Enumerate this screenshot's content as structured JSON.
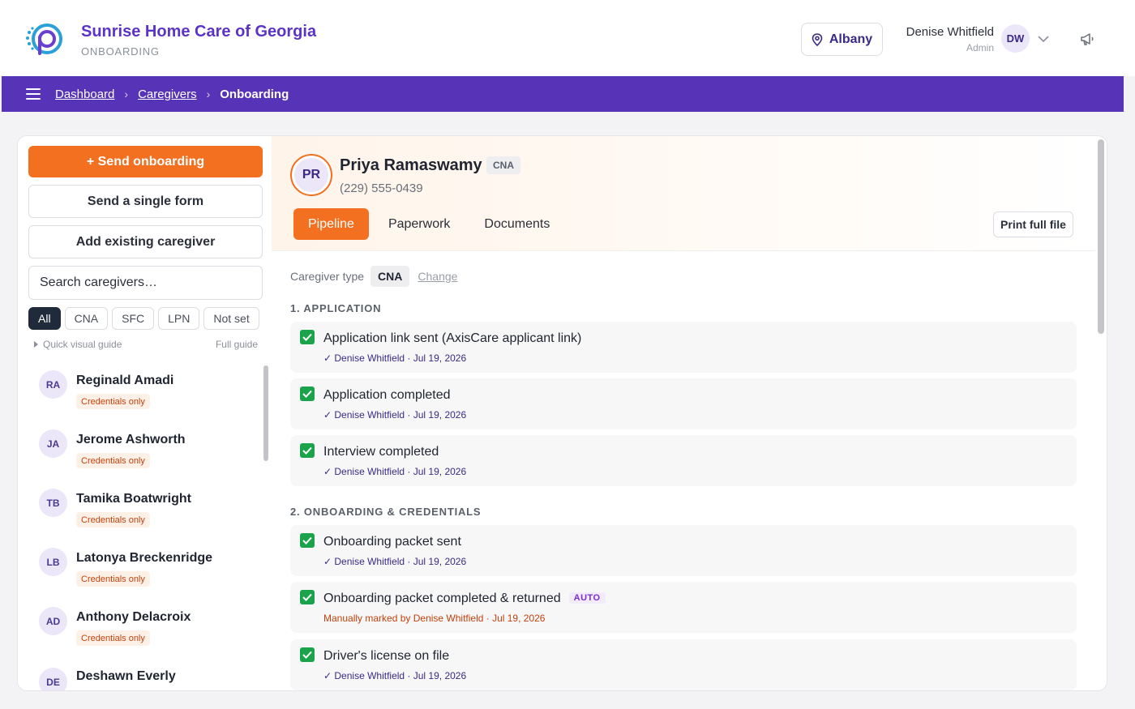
{
  "header": {
    "org_name": "Sunrise Home Care of Georgia",
    "org_sub": "ONBOARDING",
    "location": "Albany",
    "user_name": "Denise Whitfield",
    "user_role": "Admin",
    "user_initials": "DW",
    "logo_icon": "p-logo-icon",
    "brand_color": "#5b34c7",
    "accent_color": "#f37020"
  },
  "breadcrumb": {
    "items": [
      "Dashboard",
      "Caregivers"
    ],
    "current": "Onboarding"
  },
  "left": {
    "send_onboarding": "+ Send onboarding",
    "send_single_form": "Send a single form",
    "add_existing": "Add existing caregiver",
    "search_placeholder": "Search caregivers…",
    "filters": [
      "All",
      "CNA",
      "SFC",
      "LPN",
      "Not set"
    ],
    "active_filter": "All",
    "quick_guide": "Quick visual guide",
    "full_guide": "Full guide",
    "caregivers": [
      {
        "initials": "RA",
        "name": "Reginald Amadi",
        "badge": "Credentials only"
      },
      {
        "initials": "JA",
        "name": "Jerome Ashworth",
        "badge": "Credentials only"
      },
      {
        "initials": "TB",
        "name": "Tamika Boatwright",
        "badge": "Credentials only"
      },
      {
        "initials": "LB",
        "name": "Latonya Breckenridge",
        "badge": "Credentials only"
      },
      {
        "initials": "AD",
        "name": "Anthony Delacroix",
        "badge": "Credentials only"
      },
      {
        "initials": "DE",
        "name": "Deshawn Everly",
        "badge": ""
      }
    ]
  },
  "profile": {
    "initials": "PR",
    "name": "Priya Ramaswamy",
    "type_badge": "CNA",
    "phone": "(229) 555-0439",
    "tabs": [
      "Pipeline",
      "Paperwork",
      "Documents"
    ],
    "active_tab": "Pipeline",
    "print_label": "Print full file"
  },
  "pipeline": {
    "caregiver_type_label": "Caregiver type",
    "caregiver_type": "CNA",
    "change_label": "Change",
    "sections": [
      {
        "title": "1. APPLICATION",
        "steps": [
          {
            "title": "Application link sent (AxisCare applicant link)",
            "meta": "✓ Denise Whitfield · Jul 19, 2026"
          },
          {
            "title": "Application completed",
            "meta": "✓ Denise Whitfield · Jul 19, 2026"
          },
          {
            "title": "Interview completed",
            "meta": "✓ Denise Whitfield · Jul 19, 2026"
          }
        ]
      },
      {
        "title": "2. ONBOARDING & CREDENTIALS",
        "steps": [
          {
            "title": "Onboarding packet sent",
            "meta": "✓ Denise Whitfield · Jul 19, 2026"
          },
          {
            "title": "Onboarding packet completed & returned",
            "badge": "AUTO",
            "meta": "Manually marked by Denise Whitfield · Jul 19, 2026"
          },
          {
            "title": "Driver's license on file",
            "meta": "✓ Denise Whitfield · Jul 19, 2026"
          }
        ]
      }
    ]
  }
}
